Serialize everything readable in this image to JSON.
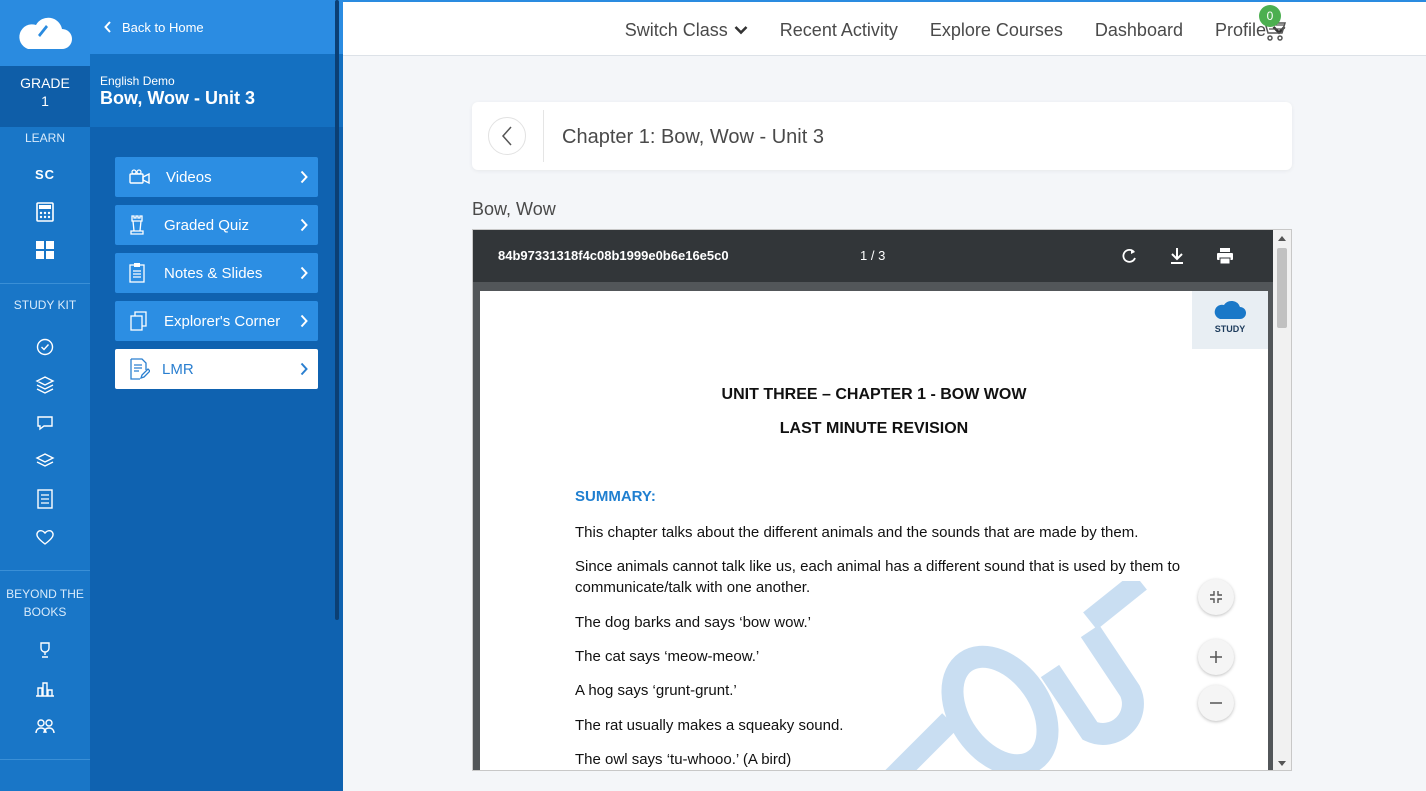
{
  "rail": {
    "grade_label": "GRADE",
    "grade_value": "1",
    "learn_label": "LEARN",
    "sc_label": "SC",
    "study_kit_label": "STUDY KIT",
    "beyond_label_1": "BEYOND THE",
    "beyond_label_2": "BOOKS"
  },
  "sidebar": {
    "back_label": "Back to Home",
    "course_sub": "English Demo",
    "course_title": "Bow, Wow - Unit 3",
    "items": [
      {
        "label": "Videos"
      },
      {
        "label": "Graded Quiz"
      },
      {
        "label": "Notes & Slides"
      },
      {
        "label": "Explorer's Corner"
      },
      {
        "label": "LMR"
      }
    ]
  },
  "topnav": {
    "switch_class": "Switch Class",
    "recent_activity": "Recent Activity",
    "explore_courses": "Explore Courses",
    "dashboard": "Dashboard",
    "profile": "Profile",
    "cart_count": "0"
  },
  "chapter": {
    "title": "Chapter 1: Bow, Wow - Unit 3",
    "doc_label": "Bow, Wow"
  },
  "viewer": {
    "filename": "84b97331318f4c08b1999e0b6e16e5c0",
    "page_indicator": "1 / 3",
    "logo_text": "STUDY"
  },
  "document": {
    "heading1": "UNIT THREE – CHAPTER 1 - BOW WOW",
    "heading2": "LAST MINUTE REVISION",
    "summary_label": "SUMMARY:",
    "p1": "This chapter talks about the different animals and the sounds that are made by them.",
    "p2": "Since animals cannot talk like us, each animal has a different sound that is used by them to communicate/talk with one another.",
    "p3": "The dog barks and says ‘bow wow.’",
    "p4": "The cat says ‘meow-meow.’",
    "p5": "A hog says ‘grunt-grunt.’",
    "p6": "The rat usually makes a squeaky sound.",
    "p7": "The owl says ‘tu-whooo.’ (A bird)"
  },
  "colors": {
    "rail_bg": "#1976c7",
    "side_bg": "#0f62b0",
    "accent": "#2a8be0",
    "badge": "#4caf50",
    "summary": "#1f7fd0"
  }
}
